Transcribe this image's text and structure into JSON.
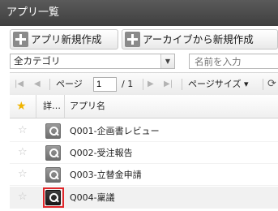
{
  "window": {
    "title": "アプリ一覧"
  },
  "actions": {
    "new_app_label": "アプリ新規作成",
    "new_from_archive_label": "アーカイブから新規作成"
  },
  "filter": {
    "category_value": "全カテゴリ",
    "name_placeholder": "名前を入力"
  },
  "pager": {
    "page_label": "ページ",
    "current_page": "1",
    "total_pages": "/ 1",
    "page_size_label": "ページサイズ ▾"
  },
  "grid": {
    "headers": {
      "detail": "詳…",
      "app_name": "アプリ名"
    },
    "rows": [
      {
        "name": "Q001-企画書レビュー"
      },
      {
        "name": "Q002-受注報告"
      },
      {
        "name": "Q003-立替金申請"
      },
      {
        "name": "Q004-稟議"
      }
    ]
  },
  "colors": {
    "titlebar": "#4a4a4a",
    "star": "#f0b400",
    "highlight": "#e0262a"
  }
}
